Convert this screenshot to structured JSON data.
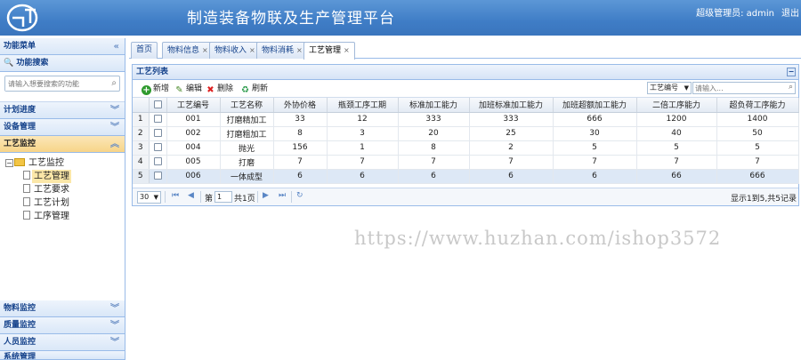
{
  "header": {
    "app_title": "制造装备物联及生产管理平台",
    "user_info": "超级管理员: admin",
    "logout": "退出"
  },
  "sidebar": {
    "menu_title": "功能菜单",
    "search_title": "功能搜索",
    "search_placeholder": "请输入想要搜索的功能",
    "groups_top": [
      {
        "label": "计划进度"
      },
      {
        "label": "设备管理"
      },
      {
        "label": "工艺监控"
      }
    ],
    "tree": {
      "root": "工艺监控",
      "items": [
        "工艺管理",
        "工艺要求",
        "工艺计划",
        "工序管理"
      ]
    },
    "groups_bottom": [
      {
        "label": "物料监控"
      },
      {
        "label": "质量监控"
      },
      {
        "label": "人员监控"
      },
      {
        "label": "系统管理"
      }
    ]
  },
  "tabs": [
    {
      "label": "首页"
    },
    {
      "label": "物料信息"
    },
    {
      "label": "物料收入"
    },
    {
      "label": "物料消耗"
    },
    {
      "label": "工艺管理"
    }
  ],
  "grid": {
    "title": "工艺列表",
    "toolbar": {
      "add": "新增",
      "edit": "编辑",
      "delete": "删除",
      "refresh": "刷新",
      "field_select": "工艺编号",
      "search_placeholder": "请输入..."
    },
    "columns": [
      "工艺编号",
      "工艺名称",
      "外协价格",
      "瓶颈工序工期",
      "标准加工能力",
      "加班标准加工能力",
      "加班超额加工能力",
      "二倍工序能力",
      "超负荷工序能力"
    ],
    "rows": [
      {
        "n": "1",
        "cells": [
          "001",
          "打磨精加工",
          "33",
          "12",
          "333",
          "333",
          "666",
          "1200",
          "1400"
        ]
      },
      {
        "n": "2",
        "cells": [
          "002",
          "打磨粗加工",
          "8",
          "3",
          "20",
          "25",
          "30",
          "40",
          "50"
        ]
      },
      {
        "n": "3",
        "cells": [
          "004",
          "抛光",
          "156",
          "1",
          "8",
          "2",
          "5",
          "5",
          "5"
        ]
      },
      {
        "n": "4",
        "cells": [
          "005",
          "打磨",
          "7",
          "7",
          "7",
          "7",
          "7",
          "7",
          "7"
        ]
      },
      {
        "n": "5",
        "cells": [
          "006",
          "一体成型",
          "6",
          "6",
          "6",
          "6",
          "6",
          "66",
          "666"
        ]
      }
    ],
    "pager": {
      "page_size": "30",
      "page_prefix": "第",
      "page_value": "1",
      "page_suffix": "共1页",
      "info": "显示1到5,共5记录"
    }
  },
  "watermark": "https://www.huzhan.com/ishop3572"
}
